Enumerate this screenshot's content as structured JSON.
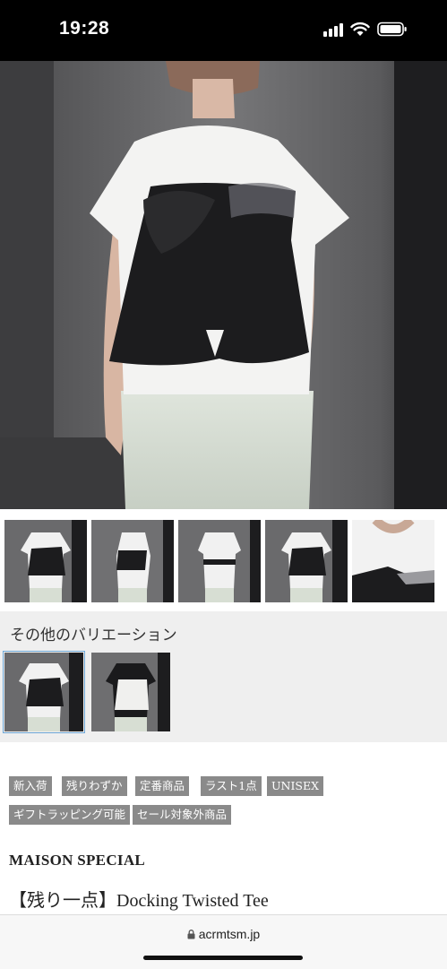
{
  "status_bar": {
    "time": "19:28",
    "icons": [
      "cellular-signal-icon",
      "wifi-icon",
      "battery-icon"
    ]
  },
  "main_image": {
    "description_icon": "product-photo"
  },
  "thumbnails": {
    "count": 5
  },
  "variations": {
    "title": "その他のバリエーション",
    "selected_index": 0
  },
  "tags": [
    "新入荷",
    "残りわずか",
    "定番商品",
    "ラスト1点",
    "UNISEX",
    "ギフトラッピング可能",
    "セール対象外商品"
  ],
  "product": {
    "brand": "MAISON SPECIAL",
    "title": "【残り一点】Docking Twisted Tee"
  },
  "url_bar": {
    "domain": "acrmtsm.jp"
  },
  "colors": {
    "tag_bg": "#8a8a8a",
    "variation_bg": "#efefef",
    "selected_outline": "#6ea7d6"
  }
}
